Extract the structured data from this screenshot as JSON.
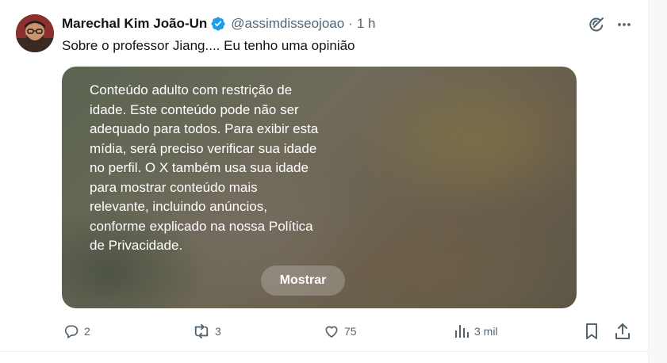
{
  "author": {
    "name": "Marechal Kim João-Un",
    "handle": "@assimdisseojoao",
    "separator": "·",
    "time": "1 h"
  },
  "tweet": {
    "text": "Sobre o professor Jiang.... Eu tenho uma opinião"
  },
  "media": {
    "warning_lines": [
      "Conteúdo adulto com restrição de",
      "idade. Este conteúdo pode não ser",
      "adequado para todos. Para exibir esta",
      "mídia, será preciso verificar sua idade",
      "no perfil. O X também usa sua idade",
      "para mostrar conteúdo mais",
      "relevante, incluindo anúncios,",
      "conforme explicado na nossa Política",
      "de Privacidade."
    ],
    "show_label": "Mostrar"
  },
  "actions": {
    "replies": "2",
    "reposts": "3",
    "likes": "75",
    "views": "3 mil"
  },
  "icons": {
    "verified": "verified-badge-icon",
    "grok": "grok-icon",
    "more": "more-icon",
    "reply": "reply-icon",
    "repost": "repost-icon",
    "like": "heart-icon",
    "views": "analytics-icon",
    "bookmark": "bookmark-icon",
    "share": "share-icon"
  },
  "colors": {
    "verified": "#1d9bf0",
    "secondary_text": "#536471",
    "primary_text": "#0f1419"
  }
}
